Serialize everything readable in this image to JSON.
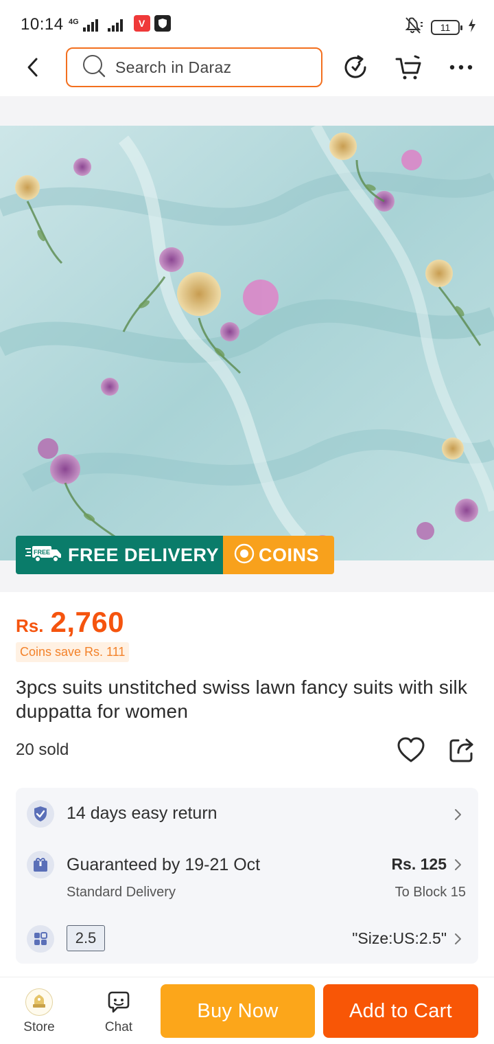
{
  "status_bar": {
    "time": "10:14",
    "network_tag": "4G",
    "battery": "11",
    "colors": {
      "vivaldi": "#ef3939",
      "shield": "#222222"
    }
  },
  "nav": {
    "search_placeholder": "Search in Daraz",
    "icons": [
      "back-arrow-icon",
      "search-icon",
      "history-icon",
      "cart-icon",
      "more-icon"
    ],
    "accent": "#f36f1e"
  },
  "product": {
    "image_alt": "Light blue floral swiss lawn fabric",
    "badges": {
      "free_delivery": "FREE DELIVERY",
      "free_icon_text": "FREE",
      "coins": "COINS",
      "colors": {
        "free": "#0a7c6a",
        "coins": "#f8a11c"
      }
    },
    "price": {
      "currency": "Rs.",
      "value": "2,760",
      "color": "#f5540e"
    },
    "coins_save": "Coins save Rs. 111",
    "title": "3pcs suits unstitched swiss lawn fancy suits with silk duppatta for women",
    "sold": "20 sold"
  },
  "services": {
    "return": {
      "label": "14 days easy return"
    },
    "delivery": {
      "label": "Guaranteed by 19-21 Oct",
      "sub": "Standard Delivery",
      "fee": "Rs. 125",
      "to": "To Block 15"
    },
    "size": {
      "chip": "2.5",
      "value": "\"Size:US:2.5\""
    }
  },
  "bottom_bar": {
    "store_label": "Store",
    "chat_label": "Chat",
    "buy_now": "Buy Now",
    "add_to_cart": "Add to Cart",
    "colors": {
      "buy": "#fca61a",
      "cart": "#f85606"
    }
  }
}
